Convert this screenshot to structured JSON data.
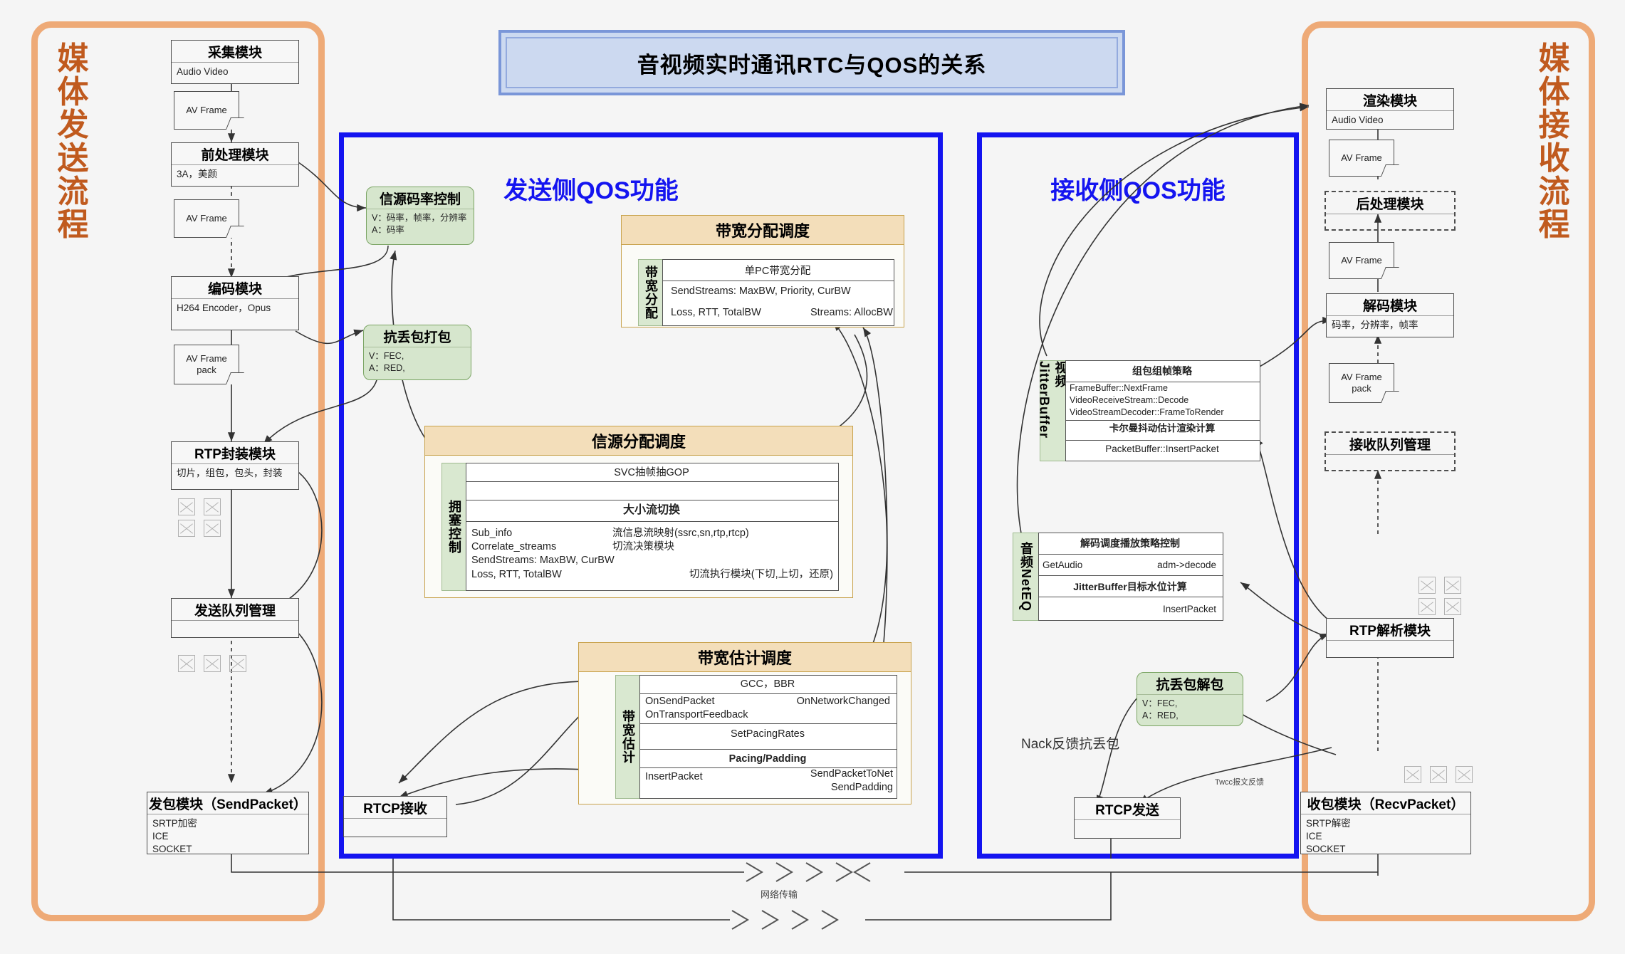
{
  "banner": {
    "title": "音视频实时通讯RTC与QOS的关系"
  },
  "left_frame": {
    "title": "媒\n体\n发\n送\n流\n程"
  },
  "right_frame": {
    "title": "媒\n体\n接\n收\n流\n程"
  },
  "send_qos_panel": {
    "title": "发送侧QOS功能"
  },
  "recv_qos_panel": {
    "title": "接收侧QOS功能"
  },
  "send_modules": [
    {
      "title": "采集模块",
      "body": "Audio Video"
    },
    {
      "title": "前处理模块",
      "body": "3A，美颜"
    },
    {
      "title": "编码模块",
      "body": "H264 Encoder，Opus"
    },
    {
      "title": "RTP封装模块",
      "body": "切片，组包，包头，封装"
    },
    {
      "title": "发送队列管理",
      "body": ""
    },
    {
      "title": "发包模块（SendPacket）",
      "body": "SRTP加密\nICE\nSOCKET"
    }
  ],
  "send_notes": [
    {
      "label": "AV Frame"
    },
    {
      "label": "AV Frame"
    },
    {
      "label": "AV Frame\npack"
    }
  ],
  "recv_modules": [
    {
      "title": "渲染模块",
      "body": "Audio Video"
    },
    {
      "title": "后处理模块",
      "body": ""
    },
    {
      "title": "解码模块",
      "body": "码率，分辨率，帧率"
    },
    {
      "title": "接收队列管理",
      "body": ""
    },
    {
      "title": "RTP解析模块",
      "body": ""
    },
    {
      "title": "收包模块（RecvPacket）",
      "body": "SRTP解密\nICE\nSOCKET"
    }
  ],
  "recv_notes": [
    {
      "label": "AV Frame"
    },
    {
      "label": "AV Frame"
    },
    {
      "label": "AV Frame\npack"
    }
  ],
  "green_boxes": {
    "source_rate_control": {
      "title": "信源码率控制",
      "body": "V：码率，帧率，分辨率\nA：码率"
    },
    "fec_packetize": {
      "title": "抗丢包打包",
      "body": "V：FEC,\nA：RED,"
    },
    "fec_depacketize": {
      "title": "抗丢包解包",
      "body": "V：FEC,\nA：RED,"
    }
  },
  "rtcp": {
    "receive": {
      "title": "RTCP接收",
      "body": ""
    },
    "send": {
      "title": "RTCP发送",
      "body": ""
    }
  },
  "bandwidth_alloc_panel": {
    "title": "带宽分配调度",
    "vlabel": "带宽分配",
    "rows": [
      {
        "center": "单PC带宽分配"
      },
      {
        "left": "SendStreams: MaxBW, Priority, CurBW"
      },
      {
        "left": "Loss, RTT, TotalBW",
        "right": "Streams: AllocBW"
      }
    ]
  },
  "source_alloc_panel": {
    "title": "信源分配调度",
    "vlabel": "拥塞控制",
    "rows": [
      {
        "center": "SVC抽帧抽GOP"
      },
      {
        "center": ""
      },
      {
        "center": "大小流切换"
      },
      {
        "left": "Sub_info\nCorrelate_streams\nSendStreams: MaxBW, CurBW",
        "mid": "流信息流映射(ssrc,sn,rtp,rtcp)\n切流决策模块",
        "bottom_left": "Loss, RTT, TotalBW",
        "bottom_right": "切流执行模块(下切,上切，还原)"
      }
    ]
  },
  "bandwidth_est_panel": {
    "title": "带宽估计调度",
    "vlabel": "带宽估计",
    "rows": [
      {
        "center": "GCC，BBR"
      },
      {
        "left": "OnSendPacket\nOnTransportFeedback",
        "right": "OnNetworkChanged"
      },
      {
        "center": "SetPacingRates"
      },
      {
        "center": "Pacing/Padding"
      },
      {
        "left": "InsertPacket",
        "right": "SendPacketToNet\nSendPadding"
      }
    ]
  },
  "video_jitterbuffer": {
    "vlabel": "视频JitterBuffer",
    "rows": [
      {
        "center": "组包组帧策略"
      },
      {
        "left": "FrameBuffer::NextFrame\nVideoReceiveStream::Decode\nVideoStreamDecoder::FrameToRender"
      },
      {
        "center": "卡尔曼抖动估计渲染计算"
      },
      {
        "center": "PacketBuffer::InsertPacket"
      }
    ]
  },
  "audio_neteq": {
    "vlabel": "音频NetEQ",
    "rows": [
      {
        "center": "解码调度播放策略控制"
      },
      {
        "left": "GetAudio",
        "right": "adm->decode"
      },
      {
        "center": "JitterBuffer目标水位计算"
      },
      {
        "right": "InsertPacket"
      }
    ]
  },
  "annotations": {
    "nack": "Nack反馈抗丢包",
    "twcc": "Twcc报文反馈",
    "network": "网络传输"
  },
  "colors": {
    "frame_orange": "#eeaa77",
    "frame_title": "#c05a1e",
    "qos_blue": "#1414f0",
    "banner_fill": "#ccd9f0",
    "green_fill": "#d6e6cd",
    "sched_head": "#f3deba",
    "sched_border": "#c8a24c"
  }
}
